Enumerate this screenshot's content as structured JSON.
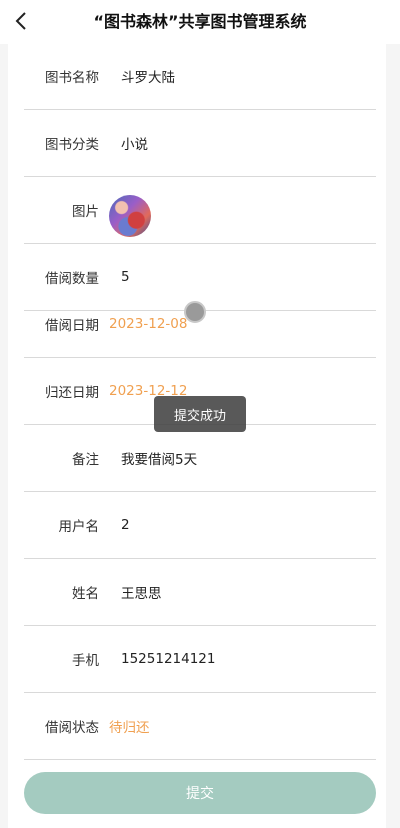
{
  "header": {
    "title": "“图书森林”共享图书管理系统",
    "back_icon": "chevron-left-icon"
  },
  "form": {
    "rows": [
      {
        "label": "图书名称",
        "value": "斗罗大陆"
      },
      {
        "label": "图书分类",
        "value": "小说"
      },
      {
        "label": "图片",
        "value": ""
      },
      {
        "label": "借阅数量",
        "value": "5"
      },
      {
        "label": "借阅日期",
        "value": "2023-12-08"
      },
      {
        "label": "归还日期",
        "value": "2023-12-12"
      },
      {
        "label": "备注",
        "value": "我要借阅5天"
      },
      {
        "label": "用户名",
        "value": "2"
      },
      {
        "label": "姓名",
        "value": "王思思"
      },
      {
        "label": "手机",
        "value": "15251214121"
      },
      {
        "label": "借阅状态",
        "value": "待归还"
      }
    ]
  },
  "submit": {
    "label": "提交"
  },
  "toast": {
    "text": "提交成功"
  },
  "colors": {
    "accent_orange": "#f0a050",
    "button_bg": "#a4cbc0"
  }
}
